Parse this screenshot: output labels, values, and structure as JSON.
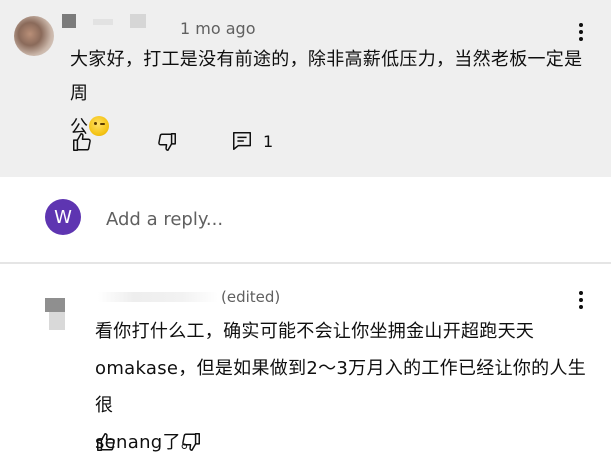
{
  "comment": {
    "time": "1 mo ago",
    "text_line1": "大家好，打工是没有前途的，除非高薪低压力，当然老板一定是周",
    "text_line2": "公",
    "reply_count": "1"
  },
  "reply_box": {
    "avatar_letter": "W",
    "placeholder": "Add a reply...",
    "avatar_color": "#5e35b1"
  },
  "reply": {
    "meta": "(edited)",
    "text_line1": "看你打什么工，确实可能不会让你坐拥金山开超跑天天",
    "text_line2": "omakase，但是如果做到2～3万月入的工作已经让你的人生很",
    "text_line3": "senang了。"
  },
  "icons": {
    "like": "thumb-up-icon",
    "dislike": "thumb-down-icon",
    "replies": "comment-replies-icon",
    "more": "more-vert-icon",
    "emoji": "winking-face-emoji"
  },
  "colors": {
    "comment_background": "#efefef",
    "secondary_text": "#606060"
  }
}
